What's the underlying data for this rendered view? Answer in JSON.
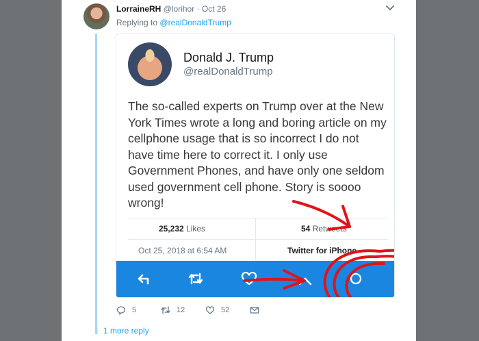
{
  "reply": {
    "display_name": "LorraineRH",
    "handle": "@lorihor",
    "separator": "·",
    "date": "Oct 26",
    "replying_prefix": "Replying to",
    "replying_to": "@realDonaldTrump",
    "menu_icon": "chevron-down-icon"
  },
  "quoted": {
    "display_name": "Donald J. Trump",
    "handle": "@realDonaldTrump",
    "text": "The so-called experts on Trump over at the New York Times wrote a long and boring article on my cellphone usage that is so incorrect I do not have time here to correct it. I only use Government Phones, and have only one seldom used government cell phone. Story is soooo wrong!",
    "likes_count": "25,232",
    "likes_label": "Likes",
    "retweets_count": "54",
    "retweets_label": "Retweets",
    "timestamp": "Oct 25, 2018 at 6:54 AM",
    "source": "Twitter for iPhone",
    "action_bar_color": "#1b86e0",
    "annotation_color": "#e0131a"
  },
  "actions": {
    "reply_count": "5",
    "retweet_count": "12",
    "like_count": "52"
  },
  "more_replies": "1 more reply",
  "colors": {
    "link": "#1da1f2",
    "thread_line": "#a9d6f3",
    "backdrop": "#6f7275"
  }
}
